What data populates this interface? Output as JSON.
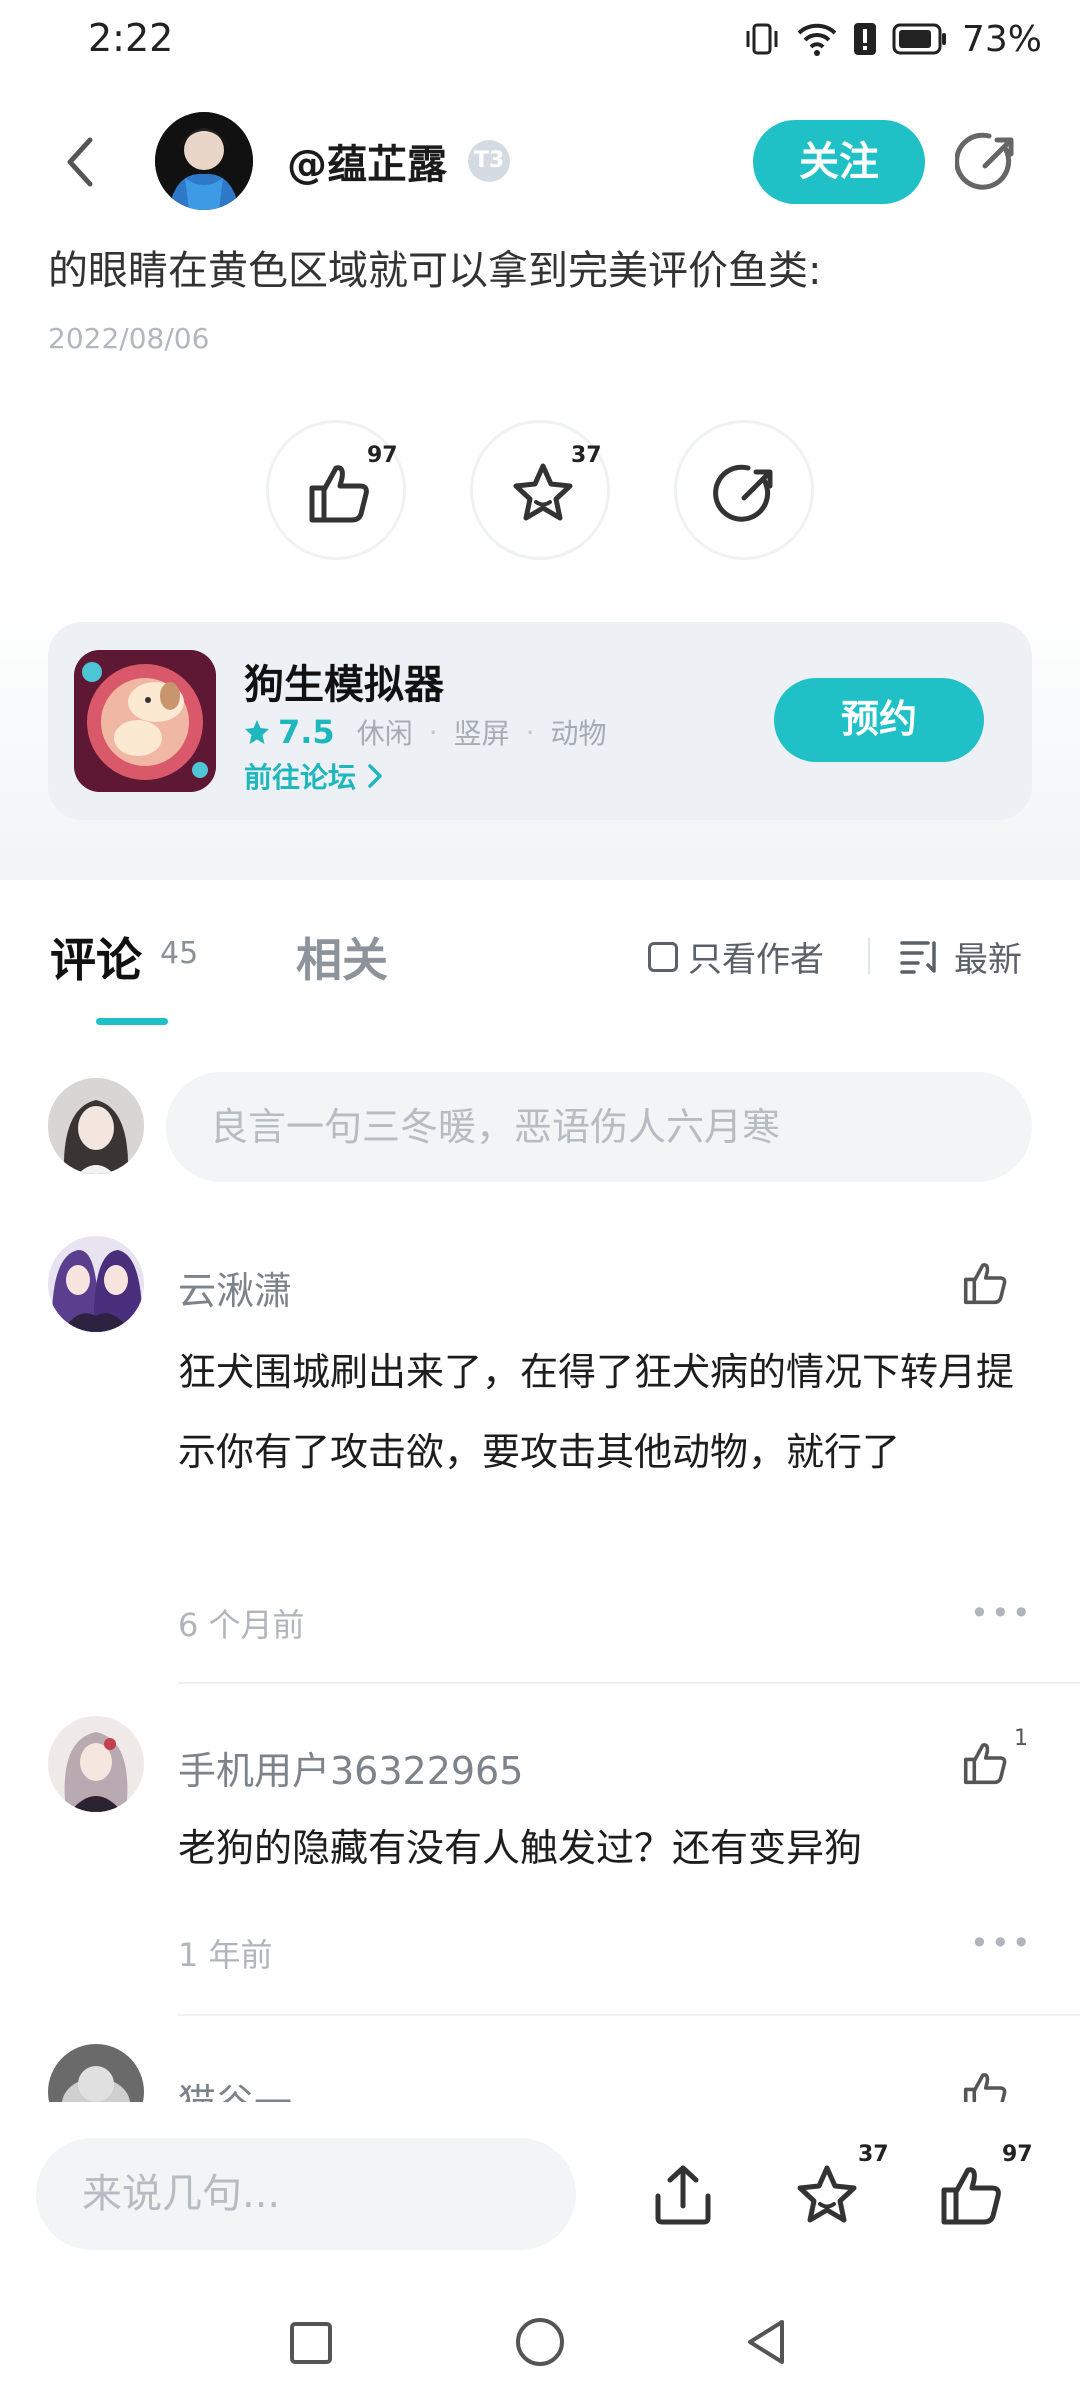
{
  "status_bar": {
    "time": "2:22",
    "battery_percent": "73%"
  },
  "header": {
    "user_name": "@蕴芷露",
    "level_badge": "T3",
    "follow_label": "关注"
  },
  "post": {
    "text": "的眼睛在黄色区域就可以拿到完美评价鱼类:",
    "date": "2022/08/06"
  },
  "actions": {
    "like_count": "97",
    "favorite_count": "37"
  },
  "game_card": {
    "title": "狗生模拟器",
    "score": "7.5",
    "tags": [
      "休闲",
      "竖屏",
      "动物"
    ],
    "forum_link": "前往论坛",
    "reserve_label": "预约"
  },
  "tabs": {
    "comments_label": "评论",
    "comments_count": "45",
    "related_label": "相关",
    "author_only_label": "只看作者",
    "sort_label": "最新"
  },
  "comment_input": {
    "placeholder": "良言一句三冬暖，恶语伤人六月寒"
  },
  "comments": [
    {
      "name": "云湫潇",
      "text": "狂犬围城刷出来了，在得了狂犬病的情况下转月提示你有了攻击欲，要攻击其他动物，就行了",
      "time": "6 个月前",
      "likes": ""
    },
    {
      "name": "手机用户36322965",
      "text": "老狗的隐藏有没有人触发过？还有变异狗",
      "time": "1 年前",
      "likes": "1"
    },
    {
      "name": "猫谷一",
      "text": "",
      "time": "",
      "likes": ""
    }
  ],
  "bottom_bar": {
    "placeholder": "来说几句...",
    "favorite_count": "37",
    "like_count": "97"
  },
  "colors": {
    "accent": "#1fc0c6",
    "text_primary": "#1b1b1b",
    "text_secondary": "#7d838a"
  }
}
